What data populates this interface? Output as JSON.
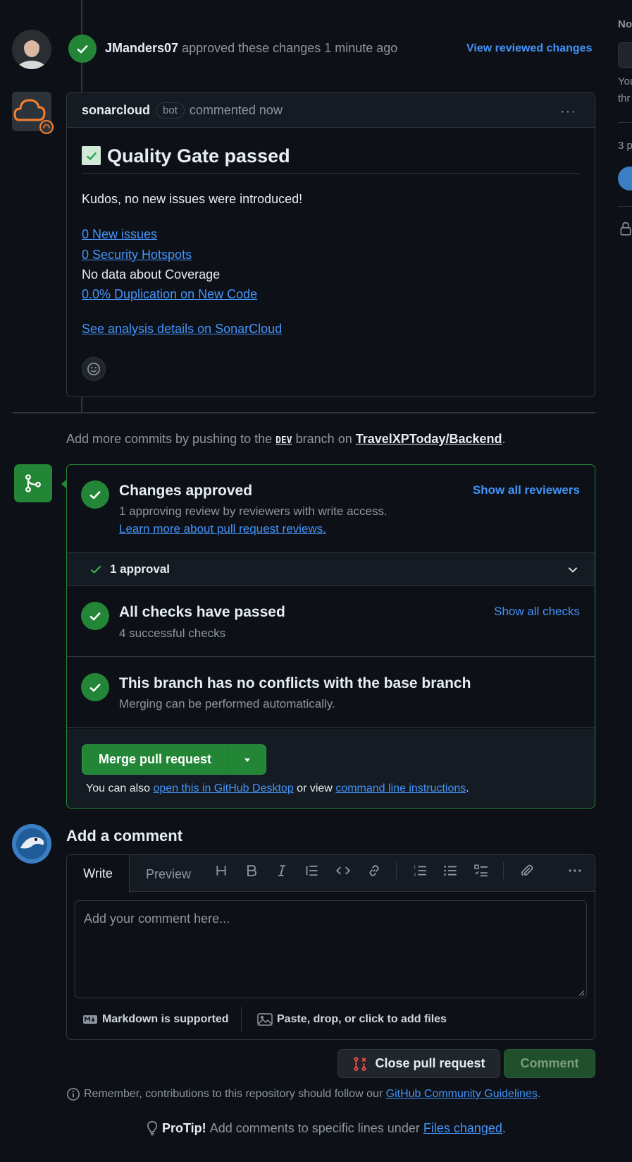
{
  "review": {
    "user": "JManders07",
    "action": "approved these changes",
    "time": "1 minute ago",
    "view_link": "View reviewed changes"
  },
  "comment": {
    "author": "sonarcloud",
    "badge": "bot",
    "meta": "commented now",
    "menu": "···",
    "heading": "Quality Gate passed",
    "kudos": "Kudos, no new issues were introduced!",
    "links": {
      "new_issues": "0 New issues",
      "hotspots": "0 Security Hotspots",
      "coverage": "No data about Coverage",
      "duplication": "0.0% Duplication on New Code",
      "analysis": "See analysis details on SonarCloud"
    }
  },
  "push_info": {
    "prefix": "Add more commits by pushing to the",
    "branch": "DEV",
    "middle": "branch on",
    "repo": "TravelXPToday/Backend",
    "suffix": "."
  },
  "merge_box": {
    "approved_title": "Changes approved",
    "approved_desc": "1 approving review by reviewers with write access.",
    "approved_link": "Learn more about pull request reviews.",
    "show_reviewers": "Show all reviewers",
    "approvals": "1 approval",
    "checks_title": "All checks have passed",
    "checks_desc": "4 successful checks",
    "show_checks": "Show all checks",
    "conflicts_title": "This branch has no conflicts with the base branch",
    "conflicts_desc": "Merging can be performed automatically.",
    "merge_button": "Merge pull request",
    "also_prefix": "You can also",
    "desktop_link": "open this in GitHub Desktop",
    "or_view": "or view",
    "cli_link": "command line instructions",
    "also_suffix": "."
  },
  "add_comment": {
    "title": "Add a comment",
    "tab_write": "Write",
    "tab_preview": "Preview",
    "placeholder": "Add your comment here...",
    "markdown": "Markdown is supported",
    "attach": "Paste, drop, or click to add files",
    "close_button": "Close pull request",
    "comment_button": "Comment",
    "guidelines_prefix": "Remember, contributions to this repository should follow our",
    "guidelines_link": "GitHub Community Guidelines",
    "guidelines_suffix": ".",
    "protip_label": "ProTip!",
    "protip_text": "Add comments to specific lines under",
    "protip_link": "Files changed",
    "protip_suffix": "."
  },
  "sidebar": {
    "notif_label": "No",
    "notif_text_1": "You",
    "notif_text_2": "thr",
    "participants": "3 p"
  },
  "colors": {
    "background": "#0d1117",
    "accent_blue": "#4493f8",
    "success_green": "#238636",
    "border": "#30363d",
    "sonar_orange": "#f6802b",
    "danger_red": "#f85149"
  }
}
